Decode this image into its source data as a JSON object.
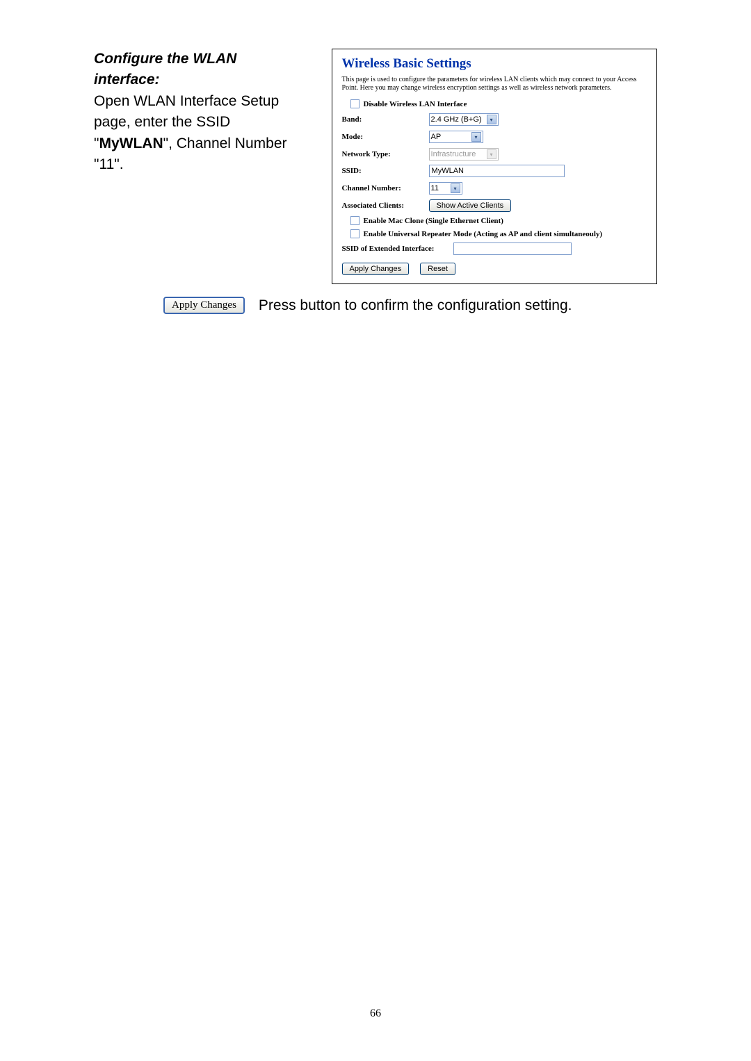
{
  "left": {
    "heading_line1": "Configure the WLAN",
    "heading_line2": "interface:",
    "body_line1": "Open WLAN Interface Setup",
    "body_line2": "page, enter the SSID",
    "body_pre_bold": "\"",
    "body_bold": "MyWLAN",
    "body_post_bold": "\", Channel Number",
    "body_line4": "\"11\"."
  },
  "panel": {
    "title": "Wireless Basic Settings",
    "desc": "This page is used to configure the parameters for wireless LAN clients which may connect to your Access Point. Here you may change wireless encryption settings as well as wireless network parameters.",
    "disable_label": "Disable Wireless LAN Interface",
    "band_label": "Band:",
    "band_value": "2.4 GHz (B+G)",
    "mode_label": "Mode:",
    "mode_value": "AP",
    "nettype_label": "Network Type:",
    "nettype_value": "Infrastructure",
    "ssid_label": "SSID:",
    "ssid_value": "MyWLAN",
    "channel_label": "Channel Number:",
    "channel_value": "11",
    "assoc_label": "Associated Clients:",
    "assoc_button": "Show Active Clients",
    "macclone_label": "Enable Mac Clone (Single Ethernet Client)",
    "urepeater_label": "Enable Universal Repeater Mode (Acting as AP and client simultaneouly)",
    "ssid_ext_label": "SSID of Extended Interface:",
    "ssid_ext_value": "",
    "apply_btn": "Apply Changes",
    "reset_btn": "Reset"
  },
  "apply": {
    "button_label": "Apply Changes",
    "caption": "Press button to confirm the configuration setting."
  },
  "page_number": "66"
}
